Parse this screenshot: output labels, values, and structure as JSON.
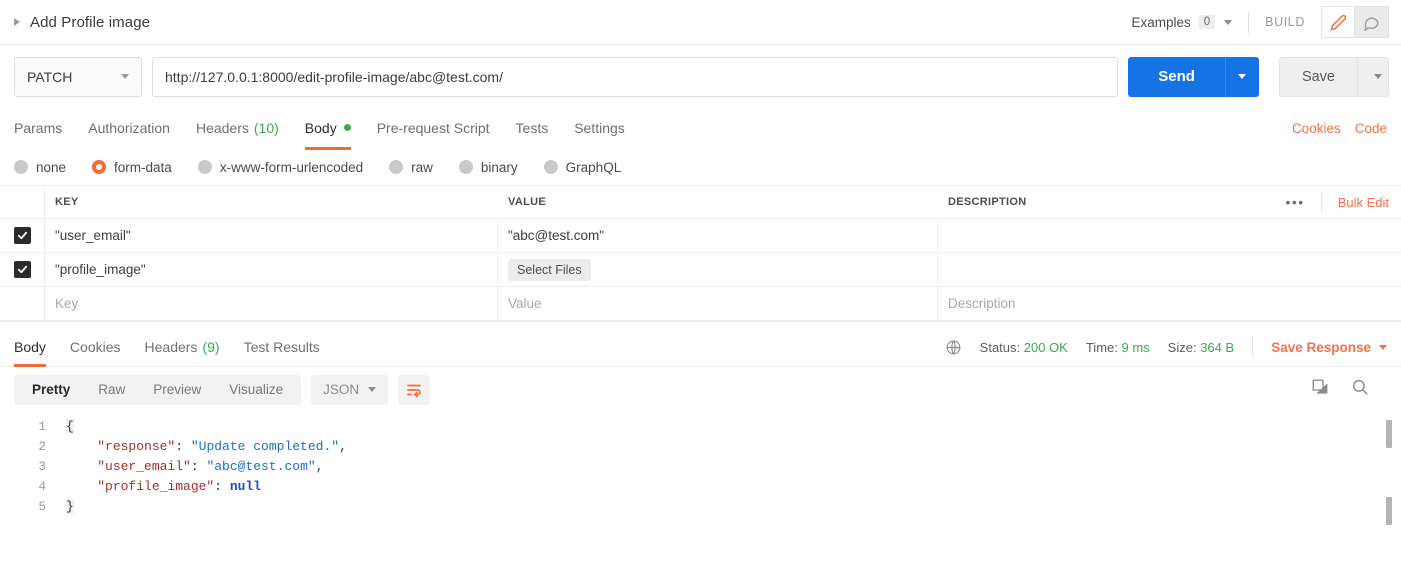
{
  "request_header": {
    "title": "Add Profile image",
    "collapse_icon": "triangle-right-icon",
    "examples_label": "Examples",
    "examples_count": "0",
    "build_label": "BUILD",
    "edit_icon": "pencil-icon",
    "comment_icon": "comment-icon"
  },
  "url_bar": {
    "method": "PATCH",
    "url": "http://127.0.0.1:8000/edit-profile-image/abc@test.com/",
    "send_label": "Send",
    "save_label": "Save"
  },
  "request_tabs": {
    "items": [
      {
        "label": "Params",
        "count": "",
        "active": false
      },
      {
        "label": "Authorization",
        "count": "",
        "active": false
      },
      {
        "label": "Headers",
        "count": "(10)",
        "active": false
      },
      {
        "label": "Body",
        "count": "",
        "active": true
      },
      {
        "label": "Pre-request Script",
        "count": "",
        "active": false
      },
      {
        "label": "Tests",
        "count": "",
        "active": false
      },
      {
        "label": "Settings",
        "count": "",
        "active": false
      }
    ],
    "cookies_label": "Cookies",
    "code_label": "Code"
  },
  "body_types": {
    "options": [
      {
        "label": "none",
        "selected": false
      },
      {
        "label": "form-data",
        "selected": true
      },
      {
        "label": "x-www-form-urlencoded",
        "selected": false
      },
      {
        "label": "raw",
        "selected": false
      },
      {
        "label": "binary",
        "selected": false
      },
      {
        "label": "GraphQL",
        "selected": false
      }
    ]
  },
  "kv_table": {
    "headers": {
      "key": "KEY",
      "value": "VALUE",
      "description": "DESCRIPTION"
    },
    "more_icon": "ellipsis-icon",
    "bulk_edit_label": "Bulk Edit",
    "rows": [
      {
        "checked": true,
        "key": "\"user_email\"",
        "value": "\"abc@test.com\"",
        "value_is_button": false,
        "description": ""
      },
      {
        "checked": true,
        "key": "\"profile_image\"",
        "value": "Select Files",
        "value_is_button": true,
        "description": ""
      }
    ],
    "placeholder_row": {
      "key": "Key",
      "value": "Value",
      "description": "Description"
    }
  },
  "response_tabs": {
    "items": [
      {
        "label": "Body",
        "count": "",
        "active": true
      },
      {
        "label": "Cookies",
        "count": "",
        "active": false
      },
      {
        "label": "Headers",
        "count": "(9)",
        "active": false
      },
      {
        "label": "Test Results",
        "count": "",
        "active": false
      }
    ],
    "globe_icon": "globe-icon",
    "status_label": "Status:",
    "status_value": "200 OK",
    "time_label": "Time:",
    "time_value": "9 ms",
    "size_label": "Size:",
    "size_value": "364 B",
    "save_response_label": "Save Response"
  },
  "response_toolbar": {
    "views": [
      {
        "label": "Pretty",
        "active": true
      },
      {
        "label": "Raw",
        "active": false
      },
      {
        "label": "Preview",
        "active": false
      },
      {
        "label": "Visualize",
        "active": false
      }
    ],
    "format": "JSON",
    "wrap_icon": "word-wrap-icon",
    "copy_icon": "copy-icon",
    "search_icon": "search-icon"
  },
  "response_body": {
    "line_numbers": [
      "1",
      "2",
      "3",
      "4",
      "5"
    ],
    "lines": [
      {
        "n": "1",
        "open_brace": "{"
      },
      {
        "n": "2",
        "key": "\"response\"",
        "colon": ": ",
        "value": "\"Update completed.\"",
        "type": "string",
        "comma": ","
      },
      {
        "n": "3",
        "key": "\"user_email\"",
        "colon": ": ",
        "value": "\"abc@test.com\"",
        "type": "string",
        "comma": ","
      },
      {
        "n": "4",
        "key": "\"profile_image\"",
        "colon": ": ",
        "value": "null",
        "type": "null",
        "comma": ""
      },
      {
        "n": "5",
        "close_brace": "}"
      }
    ]
  },
  "colors": {
    "accent_orange": "#ef6c37",
    "link_orange": "#f4714b",
    "send_blue": "#1573e6",
    "status_green": "#3bab4a"
  }
}
